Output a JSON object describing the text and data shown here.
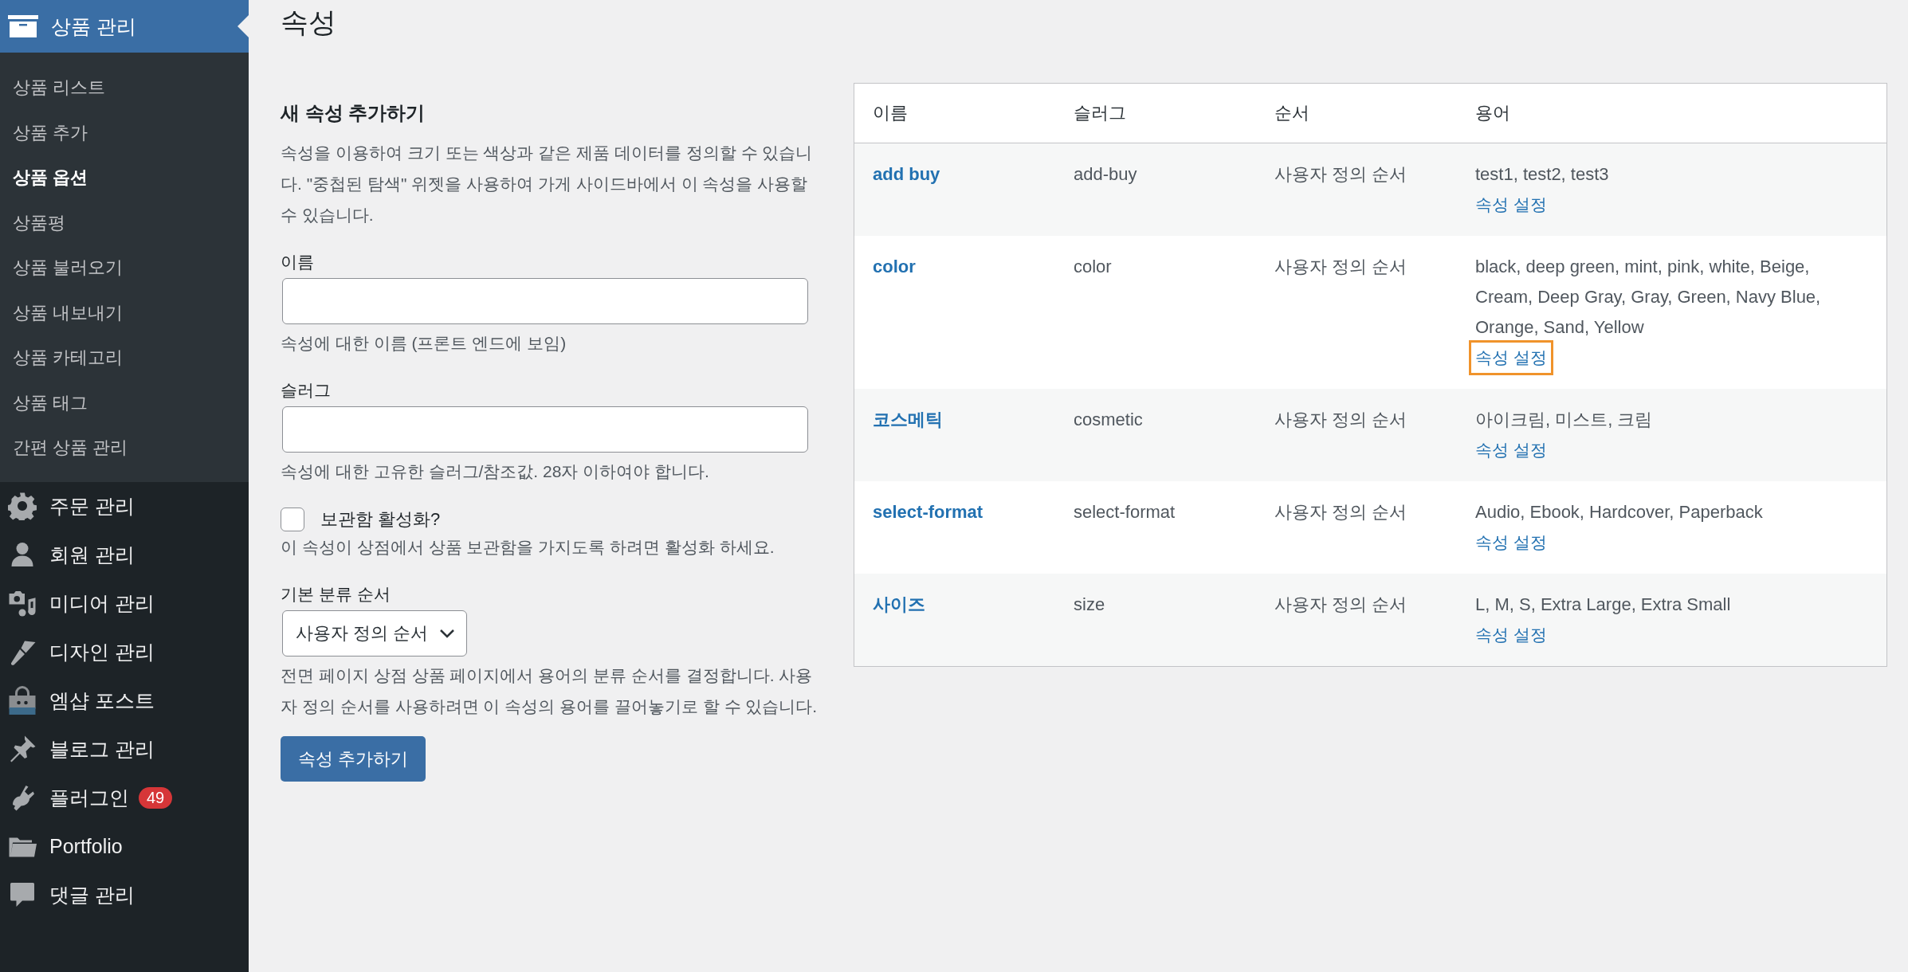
{
  "sidebar": {
    "current": {
      "label": "상품 관리",
      "selected": true
    },
    "submenu": [
      {
        "label": "상품 리스트",
        "selected": false
      },
      {
        "label": "상품 추가",
        "selected": false
      },
      {
        "label": "상품 옵션",
        "selected": true
      },
      {
        "label": "상품평",
        "selected": false
      },
      {
        "label": "상품 불러오기",
        "selected": false
      },
      {
        "label": "상품 내보내기",
        "selected": false
      },
      {
        "label": "상품 카테고리",
        "selected": false
      },
      {
        "label": "상품 태그",
        "selected": false
      },
      {
        "label": "간편 상품 관리",
        "selected": false
      }
    ],
    "menu": [
      {
        "label": "주문 관리"
      },
      {
        "label": "회원 관리"
      },
      {
        "label": "미디어 관리"
      },
      {
        "label": "디자인 관리"
      },
      {
        "label": "엠샵 포스트"
      },
      {
        "label": "블로그 관리"
      },
      {
        "label": "플러그인",
        "badge": "49"
      },
      {
        "label": "Portfolio"
      },
      {
        "label": "댓글 관리"
      }
    ]
  },
  "page_title": "속성",
  "form": {
    "heading": "새 속성 추가하기",
    "intro": "속성을 이용하여 크기 또는 색상과 같은 제품 데이터를 정의할 수 있습니다. \"중첩된 탐색\" 위젯을 사용하여 가게 사이드바에서 이 속성을 사용할 수 있습니다.",
    "name_label": "이름",
    "name_help": "속성에 대한 이름 (프론트 엔드에 보임)",
    "slug_label": "슬러그",
    "slug_help": "속성에 대한 고유한 슬러그/참조값. 28자 이하여야 합니다.",
    "archive": {
      "label": "보관함 활성화?",
      "checked": false,
      "help": "이 속성이 상점에서 상품 보관함을 가지도록 하려면 활성화 하세요."
    },
    "order_label": "기본 분류 순서",
    "order_value": "사용자 정의 순서",
    "order_help": "전면 페이지 상점 상품 페이지에서 용어의 분류 순서를 결정합니다. 사용자 정의 순서를 사용하려면 이 속성의 용어를 끌어놓기로 할 수 있습니다.",
    "submit": "속성 추가하기"
  },
  "table": {
    "columns": [
      "이름",
      "슬러그",
      "순서",
      "용어"
    ],
    "rows": [
      {
        "name": "add buy",
        "slug": "add-buy",
        "order": "사용자 정의 순서",
        "terms": "test1, test2, test3",
        "configure": "속성 설정",
        "focused": false
      },
      {
        "name": "color",
        "slug": "color",
        "order": "사용자 정의 순서",
        "terms": "black, deep green, mint, pink, white, Beige, Cream, Deep Gray, Gray, Green, Navy Blue, Orange, Sand, Yellow",
        "configure": "속성 설정",
        "focused": true
      },
      {
        "name": "코스메틱",
        "slug": "cosmetic",
        "order": "사용자 정의 순서",
        "terms": "아이크림, 미스트, 크림",
        "configure": "속성 설정",
        "focused": false
      },
      {
        "name": "select-format",
        "slug": "select-format",
        "order": "사용자 정의 순서",
        "terms": "Audio, Ebook, Hardcover, Paperback",
        "configure": "속성 설정",
        "focused": false
      },
      {
        "name": "사이즈",
        "slug": "size",
        "order": "사용자 정의 순서",
        "terms": "L, M, S, Extra Large, Extra Small",
        "configure": "속성 설정",
        "focused": false
      }
    ]
  }
}
